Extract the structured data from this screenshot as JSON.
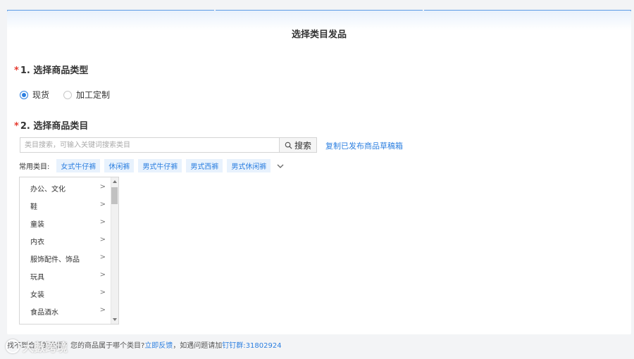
{
  "page": {
    "title": "选择类目发品"
  },
  "section1": {
    "required_mark": "*",
    "title": "1. 选择商品类型",
    "options": [
      {
        "label": "现货",
        "selected": true
      },
      {
        "label": "加工定制",
        "selected": false
      }
    ]
  },
  "section2": {
    "required_mark": "*",
    "title": "2. 选择商品类目",
    "search": {
      "placeholder": "类目搜索，可输入关键词搜索类目",
      "button_label": "搜索",
      "icon": "search-icon"
    },
    "links": {
      "copy": "复制已发布商品",
      "draft": "草稿箱"
    },
    "common": {
      "label": "常用类目:",
      "tags": [
        "女式牛仔裤",
        "休闲裤",
        "男式牛仔裤",
        "男式西裤",
        "男式休闲裤"
      ],
      "expand_icon": "chevron-down-icon"
    },
    "categories": [
      {
        "label": "办公、文化"
      },
      {
        "label": "鞋"
      },
      {
        "label": "童装"
      },
      {
        "label": "内衣"
      },
      {
        "label": "服饰配件、饰品"
      },
      {
        "label": "玩具"
      },
      {
        "label": "女装"
      },
      {
        "label": "食品酒水"
      }
    ],
    "arrow": ">"
  },
  "footer": {
    "prefix": "找不到合适的类目？您的商品属于哪个类目?",
    "feedback": "立即反馈",
    "middle": "，如遇问题请加",
    "group_label": "钉钉群:",
    "group_number": "31802924"
  },
  "watermark": {
    "text": "大數跨境"
  },
  "colors": {
    "accent": "#2c7fe0",
    "required": "#e53a2f",
    "tag_bg": "#e8f2fd"
  }
}
